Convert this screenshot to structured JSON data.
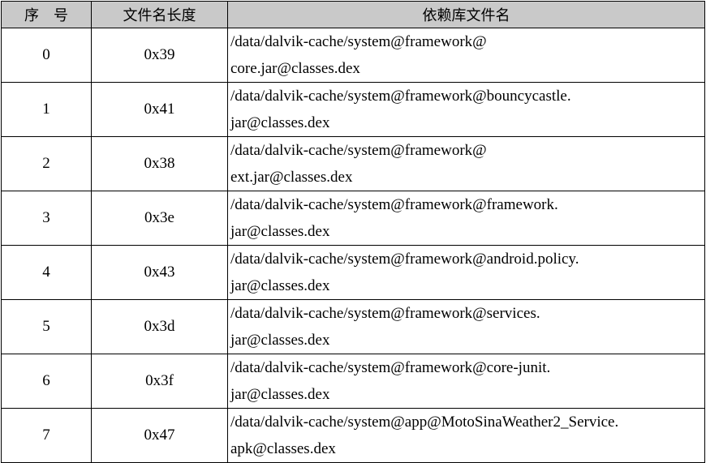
{
  "table": {
    "headers": [
      "序　号",
      "文件名长度",
      "依赖库文件名"
    ],
    "rows": [
      {
        "index": "0",
        "length": "0x39",
        "path_line1": "/data/dalvik-cache/system@framework@",
        "path_line2": "core.jar@classes.dex"
      },
      {
        "index": "1",
        "length": "0x41",
        "path_line1": "/data/dalvik-cache/system@framework@bouncycastle.",
        "path_line2": "jar@classes.dex"
      },
      {
        "index": "2",
        "length": "0x38",
        "path_line1": "/data/dalvik-cache/system@framework@",
        "path_line2": "ext.jar@classes.dex"
      },
      {
        "index": "3",
        "length": "0x3e",
        "path_line1": "/data/dalvik-cache/system@framework@framework.",
        "path_line2": "jar@classes.dex"
      },
      {
        "index": "4",
        "length": "0x43",
        "path_line1": "/data/dalvik-cache/system@framework@android.policy.",
        "path_line2": "jar@classes.dex"
      },
      {
        "index": "5",
        "length": "0x3d",
        "path_line1": "/data/dalvik-cache/system@framework@services.",
        "path_line2": "jar@classes.dex"
      },
      {
        "index": "6",
        "length": "0x3f",
        "path_line1": "/data/dalvik-cache/system@framework@core-junit.",
        "path_line2": "jar@classes.dex"
      },
      {
        "index": "7",
        "length": "0x47",
        "path_line1": "/data/dalvik-cache/system@app@MotoSinaWeather2_Service.",
        "path_line2": "apk@classes.dex"
      }
    ]
  },
  "colors": {
    "header_background": "#c9c9c9",
    "border": "#000000",
    "text": "#000000"
  }
}
